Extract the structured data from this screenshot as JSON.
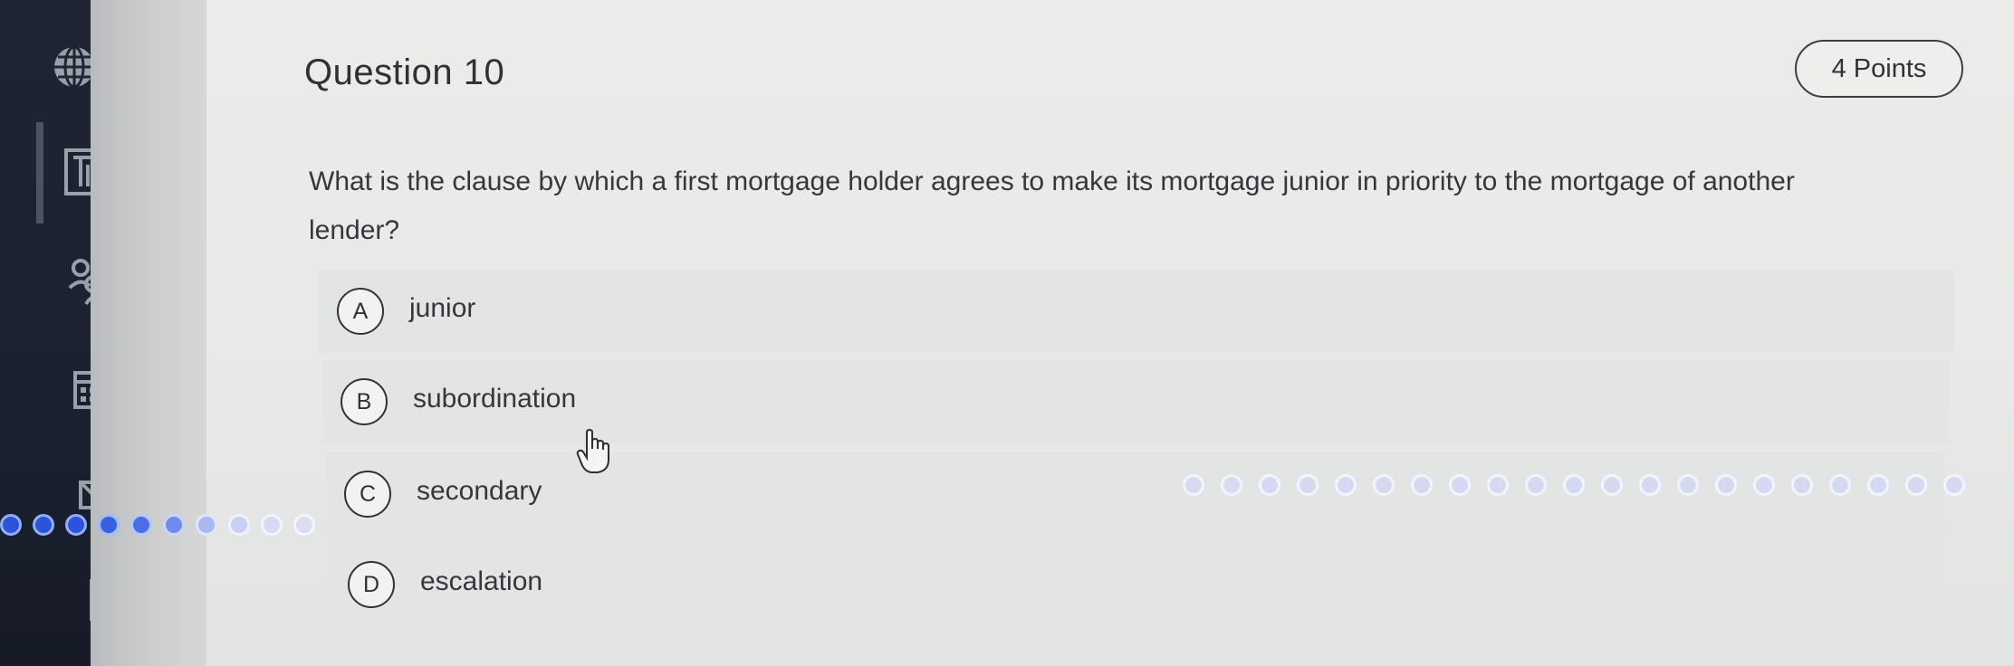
{
  "question": {
    "title": "Question 10",
    "points": "4 Points",
    "text": "What is the clause by which a first mortgage holder agrees to make its mortgage junior in priority to the mortgage of another lender?"
  },
  "options": [
    {
      "letter": "A",
      "text": "junior"
    },
    {
      "letter": "B",
      "text": "subordination"
    },
    {
      "letter": "C",
      "text": "secondary"
    },
    {
      "letter": "D",
      "text": "escalation"
    }
  ],
  "sidebar": {
    "icons": [
      "globe-icon",
      "book-icon",
      "people-icon",
      "calendar-icon",
      "inbox-icon",
      "document-icon"
    ]
  },
  "colors": {
    "sidebar_bg": "#1e2432",
    "page_bg": "#e9ebea",
    "option_bg": "#e3e5e4",
    "text": "#34383c",
    "glare_dots": "#2f5fe0"
  }
}
